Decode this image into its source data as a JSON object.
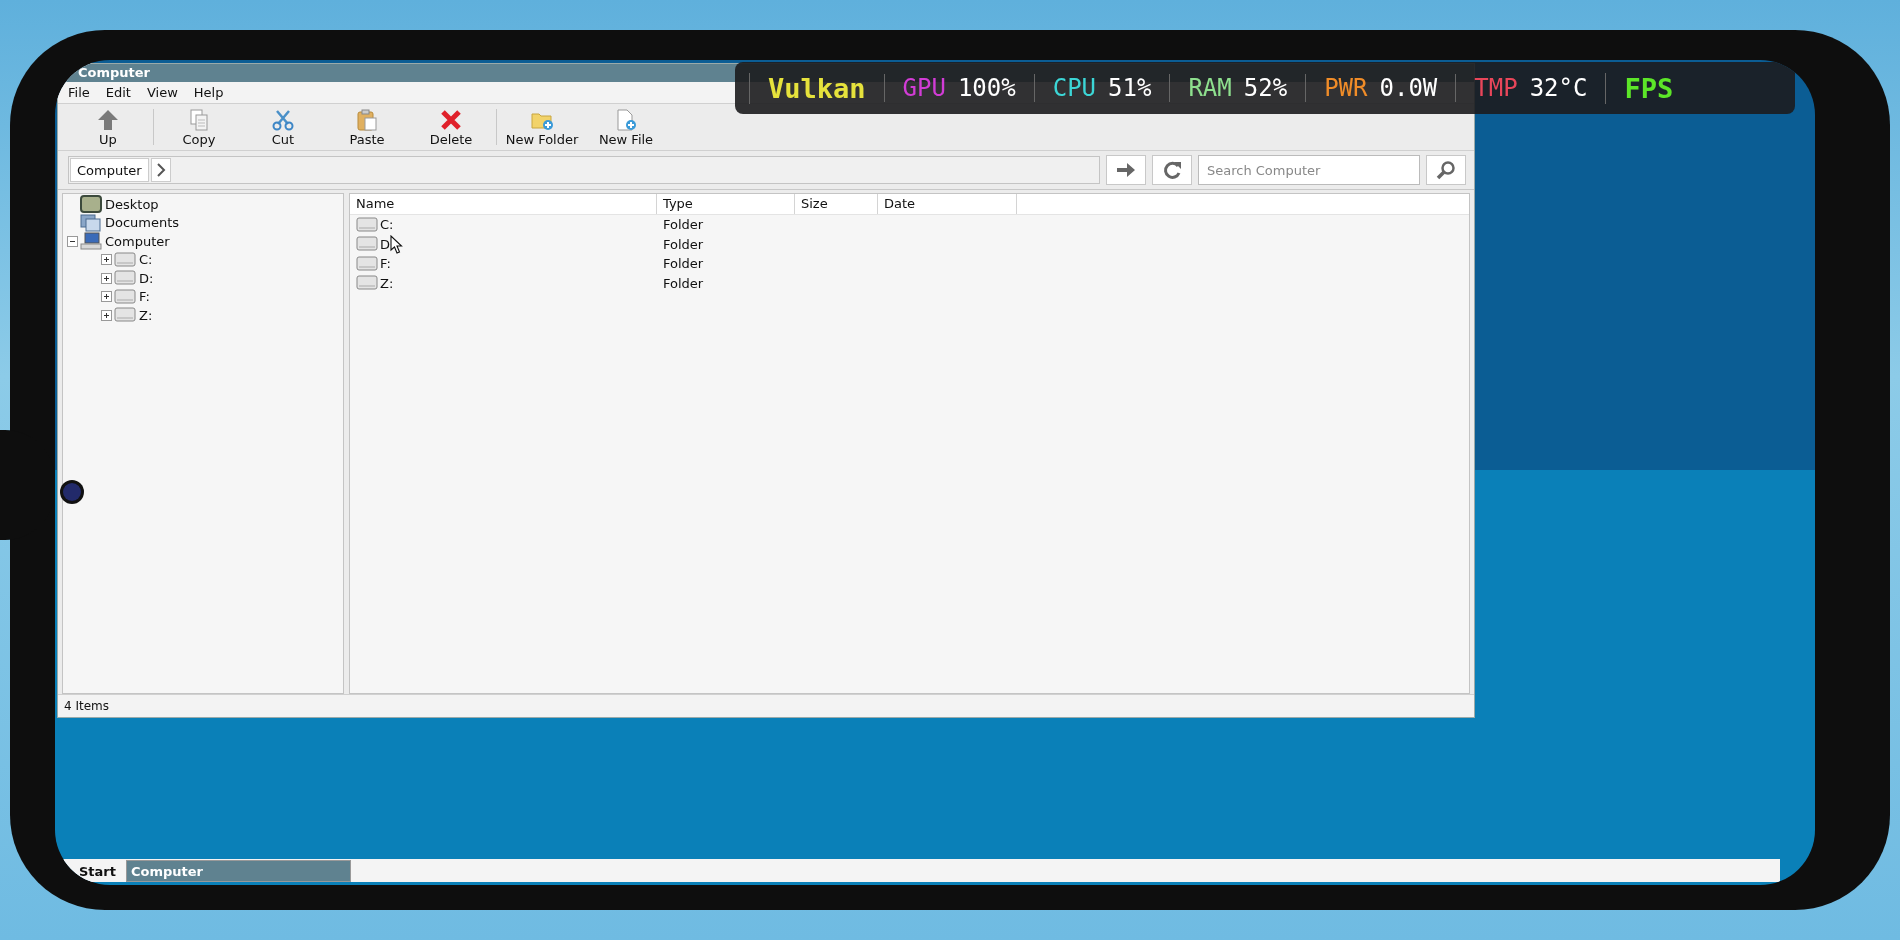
{
  "window": {
    "title": "Computer"
  },
  "menu": [
    "File",
    "Edit",
    "View",
    "Help"
  ],
  "toolbar": [
    {
      "label": "Up",
      "kind": "up"
    },
    {
      "kind": "separator"
    },
    {
      "label": "Copy",
      "kind": "copy"
    },
    {
      "label": "Cut",
      "kind": "cut"
    },
    {
      "label": "Paste",
      "kind": "paste"
    },
    {
      "label": "Delete",
      "kind": "delete"
    },
    {
      "kind": "separator"
    },
    {
      "label": "New Folder",
      "kind": "new_folder"
    },
    {
      "label": "New File",
      "kind": "new_file"
    }
  ],
  "address": {
    "crumbs": [
      "Computer"
    ],
    "search_placeholder": "Search Computer"
  },
  "tree": [
    {
      "label": "Desktop",
      "kind": "desktop"
    },
    {
      "label": "Documents",
      "kind": "documents"
    },
    {
      "label": "Computer",
      "kind": "computer",
      "expanded": true,
      "children": [
        {
          "label": "C:",
          "kind": "drive",
          "expanded": false
        },
        {
          "label": "D:",
          "kind": "drive",
          "expanded": false
        },
        {
          "label": "F:",
          "kind": "drive",
          "expanded": false
        },
        {
          "label": "Z:",
          "kind": "drive",
          "expanded": false
        }
      ]
    }
  ],
  "files": {
    "columns": [
      "Name",
      "Type",
      "Size",
      "Date"
    ],
    "rows": [
      {
        "name": "C:",
        "type": "Folder"
      },
      {
        "name": "D",
        "type": "Folder"
      },
      {
        "name": "F:",
        "type": "Folder"
      },
      {
        "name": "Z:",
        "type": "Folder"
      }
    ]
  },
  "status_bar": "4 Items",
  "overlay": [
    {
      "label": "Vulkan",
      "color": "#e6e23c"
    },
    {
      "label": "GPU",
      "value": "100%",
      "color": "#d23cd6"
    },
    {
      "label": "CPU",
      "value": "51%",
      "color": "#3cd6d6"
    },
    {
      "label": "RAM",
      "value": "52%",
      "color": "#8ee08e"
    },
    {
      "label": "PWR",
      "value": "0.0W",
      "color": "#f08c28"
    },
    {
      "label": "TMP",
      "value": "32°C",
      "color": "#e8465a"
    },
    {
      "label": "FPS",
      "color": "#5ce628"
    }
  ],
  "taskbar": {
    "start": "Start",
    "tasks": [
      {
        "label": "Computer",
        "selected": true
      }
    ]
  }
}
